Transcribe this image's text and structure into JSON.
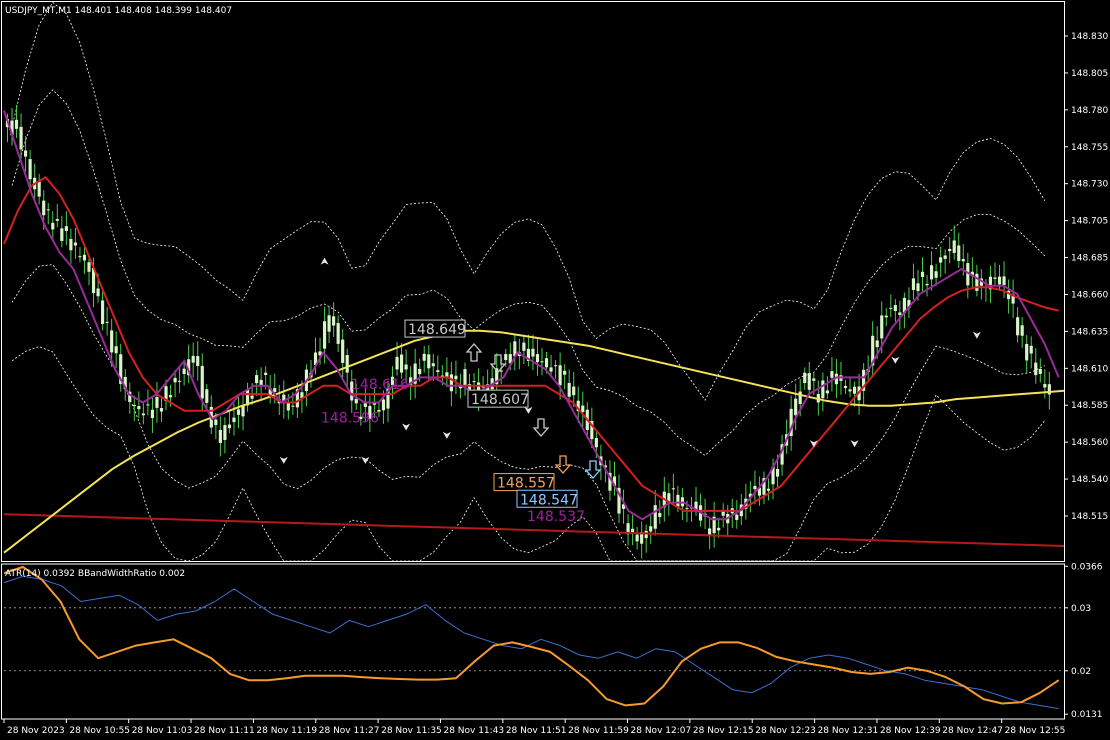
{
  "header": {
    "main_title": "USDJPY_MT,M1  148.401 148.408 148.399 148.407",
    "indicator_title": "ATR(14) 0.0392  BBandWidthRatio 0.002"
  },
  "colors": {
    "background": "#000000",
    "candle_body": "#d8f5c8",
    "wick": "#4ad04a",
    "ma_purple": "#9a2a9a",
    "ma_red": "#d42020",
    "ma_orange": "#f5a623",
    "ma_yellow": "#f2e35a",
    "ma_darkred": "#b81818",
    "bb": "#ffffff",
    "atr": "#3d6fd0",
    "bbwr": "#f59a2c"
  },
  "chart_data": [
    {
      "type": "candlestick",
      "title": "USDJPY_MT,M1",
      "ylim": [
        148.51,
        148.845
      ],
      "y_ticks": [
        "148.830",
        "148.805",
        "148.780",
        "148.755",
        "148.730",
        "148.705",
        "148.685",
        "148.660",
        "148.635",
        "148.610",
        "148.585",
        "148.560",
        "148.540",
        "148.515"
      ],
      "x_ticks": [
        "28 Nov 2023",
        "28 Nov 10:55",
        "28 Nov 11:03",
        "28 Nov 11:11",
        "28 Nov 11:19",
        "28 Nov 11:27",
        "28 Nov 11:35",
        "28 Nov 11:43",
        "28 Nov 11:51",
        "28 Nov 11:59",
        "28 Nov 12:07",
        "28 Nov 12:15",
        "28 Nov 12:23",
        "28 Nov 12:31",
        "28 Nov 12:39",
        "28 Nov 12:47",
        "28 Nov 12:55"
      ],
      "series": [
        {
          "name": "",
          "kind": "price",
          "values": [
            148.77,
            148.74,
            148.72,
            148.71,
            148.7,
            148.69,
            148.665,
            148.64,
            148.61,
            148.6,
            148.6,
            148.61,
            148.62,
            148.635,
            148.6,
            148.585,
            148.595,
            148.61,
            148.62,
            148.61,
            148.6,
            148.615,
            148.63,
            148.66,
            148.63,
            148.6,
            148.6,
            148.605,
            148.63,
            148.62,
            148.63,
            148.625,
            148.615,
            148.62,
            148.61,
            148.62,
            148.63,
            148.64,
            148.63,
            148.63,
            148.62,
            148.61,
            148.59,
            148.57,
            148.55,
            148.53,
            148.52,
            148.54,
            148.55,
            148.545,
            148.54,
            148.53,
            148.535,
            148.54,
            148.55,
            148.555,
            148.565,
            148.6,
            148.62,
            148.61,
            148.62,
            148.615,
            148.61,
            148.64,
            148.66,
            148.66,
            148.675,
            148.68,
            148.69,
            148.7,
            148.68,
            148.675,
            148.68,
            148.67,
            148.64,
            148.625,
            148.61
          ]
        },
        {
          "name": "",
          "kind": "ma",
          "values": [
            148.78,
            148.755,
            148.73,
            148.71,
            148.695,
            148.685,
            148.665,
            148.645,
            148.625,
            148.61,
            148.605,
            148.61,
            148.62,
            148.63,
            148.61,
            148.595,
            148.6,
            148.61,
            148.615,
            148.615,
            148.605,
            148.61,
            148.62,
            148.635,
            148.625,
            148.61,
            148.605,
            148.605,
            148.615,
            148.615,
            148.62,
            148.62,
            148.615,
            148.615,
            148.61,
            148.615,
            148.62,
            148.635,
            148.63,
            148.625,
            148.615,
            148.6,
            148.585,
            148.57,
            148.555,
            148.54,
            148.535,
            148.54,
            148.545,
            148.545,
            148.54,
            148.535,
            148.535,
            148.54,
            148.55,
            148.56,
            148.575,
            148.595,
            148.61,
            148.615,
            148.62,
            148.62,
            148.62,
            148.635,
            148.65,
            148.66,
            148.67,
            148.675,
            148.68,
            148.685,
            148.68,
            148.675,
            148.675,
            148.67,
            148.655,
            148.64,
            148.62
          ]
        },
        {
          "name": "",
          "kind": "ma",
          "values": [
            148.7,
            148.72,
            148.735,
            148.74,
            148.73,
            148.715,
            148.695,
            148.675,
            148.655,
            148.635,
            148.62,
            148.61,
            148.605,
            148.6,
            148.6,
            148.6,
            148.605,
            148.61,
            148.61,
            148.61,
            148.605,
            148.605,
            148.61,
            148.615,
            148.615,
            148.61,
            148.61,
            148.61,
            148.61,
            148.615,
            148.615,
            148.62,
            148.62,
            148.615,
            148.615,
            148.615,
            148.615,
            148.615,
            148.615,
            148.615,
            148.61,
            148.605,
            148.595,
            148.585,
            148.575,
            148.565,
            148.555,
            148.55,
            148.545,
            148.54,
            148.54,
            148.54,
            148.54,
            148.54,
            148.545,
            148.55,
            148.555,
            148.565,
            148.575,
            148.585,
            148.595,
            148.605,
            148.615,
            148.625,
            148.635,
            148.645,
            148.655,
            148.662,
            148.668,
            148.672,
            148.674,
            148.674,
            148.672,
            148.668,
            148.665,
            148.662,
            148.66
          ]
        },
        {
          "name": "",
          "kind": "ma",
          "values": [
            148.515,
            148.525,
            148.535,
            148.545,
            148.555,
            148.565,
            148.573,
            148.58,
            148.587,
            148.593,
            148.598,
            148.603,
            148.607,
            148.612,
            148.617,
            148.622,
            148.627,
            148.632,
            148.637,
            148.642,
            148.645,
            148.648,
            148.648,
            148.647,
            148.645,
            148.643,
            148.641,
            148.639,
            148.636,
            148.633,
            148.63,
            148.627,
            148.624,
            148.621,
            148.618,
            148.615,
            148.612,
            148.609,
            148.606,
            148.604,
            148.603,
            148.603,
            148.604,
            148.605,
            148.607,
            148.608,
            148.609,
            148.61,
            148.611,
            148.612
          ]
        },
        {
          "name": "",
          "kind": "ma",
          "values": [
            148.538,
            148.537,
            148.536,
            148.535,
            148.534,
            148.533,
            148.532,
            148.531,
            148.53,
            148.529,
            148.528,
            148.527,
            148.526,
            148.525,
            148.524,
            148.523,
            148.522,
            148.521,
            148.52,
            148.519
          ]
        }
      ],
      "price_labels": [
        {
          "text": "148.649",
          "color": "#c8c8c8"
        },
        {
          "text": "148.616",
          "color": "#a020a0"
        },
        {
          "text": "148.607",
          "color": "#c8c8c8"
        },
        {
          "text": "148.596",
          "color": "#a020a0"
        },
        {
          "text": "148.557",
          "color": "#f5a05a"
        },
        {
          "text": "148.547",
          "color": "#8ec8ff"
        },
        {
          "text": "148.537",
          "color": "#a020a0"
        }
      ]
    },
    {
      "type": "line",
      "title": "ATR(14) 0.0392  BBandWidthRatio 0.002",
      "ylim": [
        0.0125,
        0.0368
      ],
      "y_ticks": [
        "0.0366",
        "0.03",
        "0.02",
        "0.0131"
      ],
      "series": [
        {
          "name": "ATR(14)",
          "values": [
            0.034,
            0.035,
            0.0345,
            0.0335,
            0.031,
            0.0315,
            0.032,
            0.0305,
            0.028,
            0.029,
            0.0295,
            0.031,
            0.033,
            0.031,
            0.029,
            0.028,
            0.027,
            0.026,
            0.028,
            0.027,
            0.028,
            0.029,
            0.0305,
            0.028,
            0.026,
            0.025,
            0.024,
            0.0235,
            0.025,
            0.024,
            0.0225,
            0.022,
            0.023,
            0.022,
            0.0235,
            0.023,
            0.021,
            0.019,
            0.017,
            0.0165,
            0.018,
            0.0205,
            0.022,
            0.0225,
            0.022,
            0.021,
            0.02,
            0.0195,
            0.0185,
            0.018,
            0.0175,
            0.017,
            0.016,
            0.015,
            0.0145,
            0.014
          ]
        },
        {
          "name": "BBandWidthRatio",
          "values": [
            0.0355,
            0.0365,
            0.0345,
            0.031,
            0.025,
            0.022,
            0.023,
            0.024,
            0.0245,
            0.025,
            0.0235,
            0.022,
            0.0195,
            0.0185,
            0.0185,
            0.0188,
            0.0192,
            0.0192,
            0.0192,
            0.019,
            0.0188,
            0.0187,
            0.0186,
            0.0186,
            0.0188,
            0.0215,
            0.024,
            0.0245,
            0.0238,
            0.023,
            0.0208,
            0.0185,
            0.0155,
            0.0145,
            0.0148,
            0.0175,
            0.0215,
            0.0235,
            0.0245,
            0.0245,
            0.0236,
            0.0222,
            0.0215,
            0.021,
            0.0205,
            0.0198,
            0.0195,
            0.0198,
            0.0205,
            0.02,
            0.019,
            0.0175,
            0.0155,
            0.0148,
            0.015,
            0.0165,
            0.0185
          ]
        }
      ]
    }
  ]
}
